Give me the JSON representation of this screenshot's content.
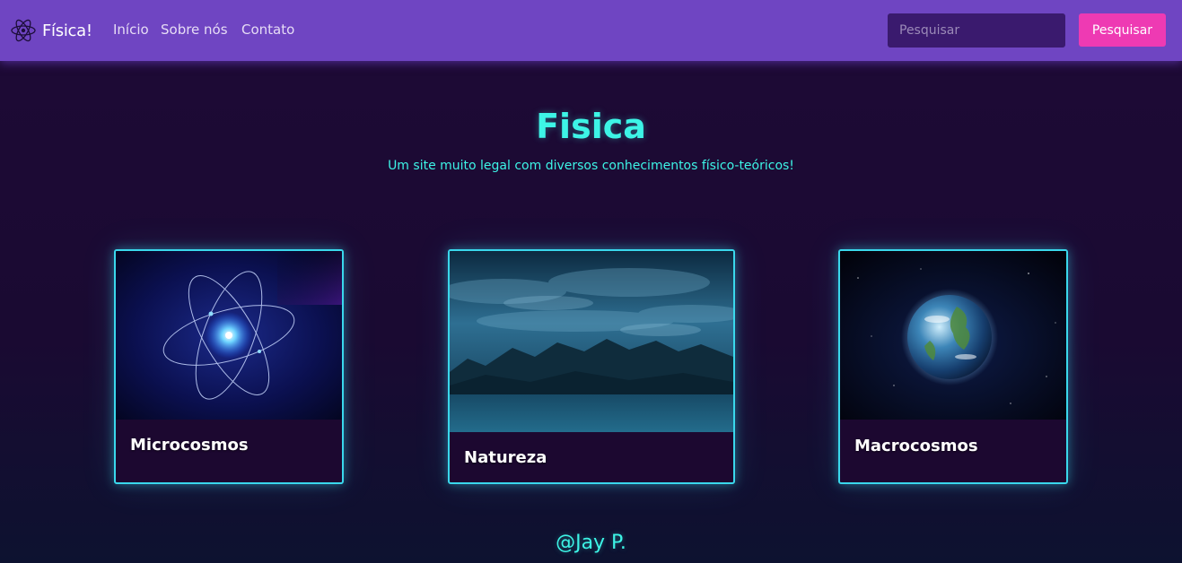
{
  "navbar": {
    "brand_text": "Física!",
    "brand_icon": "atom-icon",
    "links": [
      {
        "label": "Início"
      },
      {
        "label": "Sobre nós"
      },
      {
        "label": "Contato"
      }
    ],
    "search": {
      "placeholder": "Pesquisar",
      "value": "",
      "button_label": "Pesquisar"
    },
    "background_color": "#6f45c2",
    "button_color": "#ee3ab3"
  },
  "hero": {
    "title": "Fisica",
    "subtitle": "Um site muito legal com diversos conhecimentos físico-teóricos!",
    "accent_color": "#3df4e6"
  },
  "cards": [
    {
      "title": "Microcosmos",
      "image": "atom-orbit-image"
    },
    {
      "title": "Natureza",
      "image": "mountain-lake-image"
    },
    {
      "title": "Macrocosmos",
      "image": "earth-space-image"
    }
  ],
  "footer": {
    "text": "@Jay P."
  },
  "colors": {
    "card_border": "#3ad8ec",
    "page_background": "#1e0a36"
  }
}
